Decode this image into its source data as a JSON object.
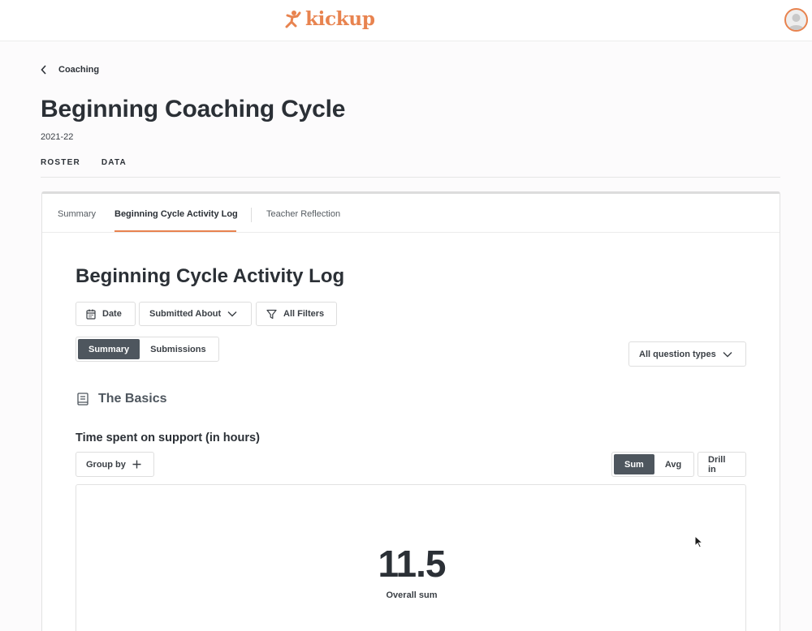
{
  "brand": {
    "name": "kickup",
    "accent": "#e8834f"
  },
  "breadcrumb": {
    "label": "Coaching"
  },
  "page": {
    "title": "Beginning Coaching Cycle",
    "year": "2021-22"
  },
  "main_tabs": [
    {
      "label": "ROSTER"
    },
    {
      "label": "DATA",
      "active": true
    }
  ],
  "sub_tabs": [
    {
      "label": "Summary"
    },
    {
      "label": "Beginning Cycle Activity Log",
      "active": true
    },
    {
      "label": "Teacher Reflection"
    }
  ],
  "log": {
    "title": "Beginning Cycle Activity Log",
    "filters": {
      "date": "Date",
      "submitted_about": "Submitted About",
      "all_filters": "All Filters"
    },
    "view_toggle": {
      "summary": "Summary",
      "submissions": "Submissions",
      "selected": "Summary"
    },
    "question_types": "All question types"
  },
  "section": {
    "title": "The Basics"
  },
  "question": {
    "title": "Time spent on support (in hours)",
    "group_by": "Group by",
    "agg_toggle": {
      "sum": "Sum",
      "avg": "Avg",
      "selected": "Sum"
    },
    "drill_in": "Drill in",
    "metric": {
      "value": "11.5",
      "label": "Overall sum"
    }
  },
  "icons": [
    "kickup-logo-icon",
    "avatar-icon",
    "chevron-left-icon",
    "calendar-icon",
    "chevron-down-icon",
    "filter-icon",
    "book-icon",
    "plus-icon",
    "cursor-icon"
  ]
}
